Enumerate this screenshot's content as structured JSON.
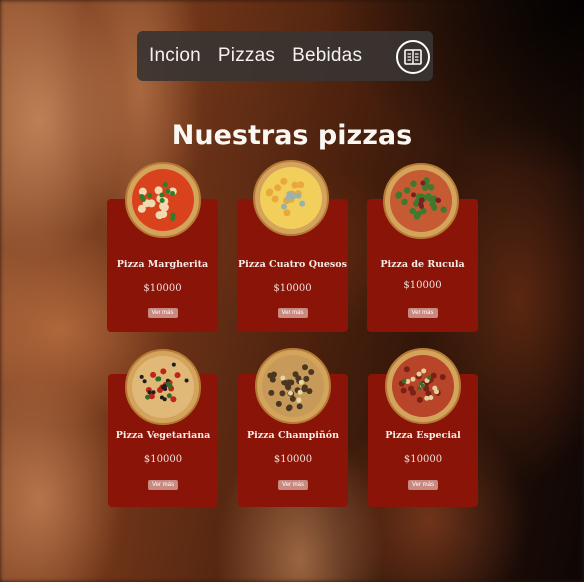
{
  "nav": {
    "links": [
      "Incion",
      "Pizzas",
      "Bebidas"
    ],
    "menu_icon": "menu-book-icon"
  },
  "title": "Nuestras pizzas",
  "pizzas": [
    {
      "name": "Pizza Margherita",
      "price": "$10000",
      "button": "Ver más",
      "style": "margherita"
    },
    {
      "name": "Pizza Cuatro Quesos",
      "price": "$10000",
      "button": "Ver más",
      "style": "quesos"
    },
    {
      "name": "Pizza de Rucula",
      "price": "$10000",
      "button": "Ver más",
      "style": "rucula"
    },
    {
      "name": "Pizza Vegetariana",
      "price": "$10000",
      "button": "Ver más",
      "style": "vegetariana"
    },
    {
      "name": "Pizza Champiñón",
      "price": "$10000",
      "button": "Ver más",
      "style": "champinon"
    },
    {
      "name": "Pizza Especial",
      "price": "$10000",
      "button": "Ver más",
      "style": "especial"
    }
  ],
  "colors": {
    "card": "#8b1409",
    "nav": "#3a3432",
    "button": "#c88a80"
  }
}
